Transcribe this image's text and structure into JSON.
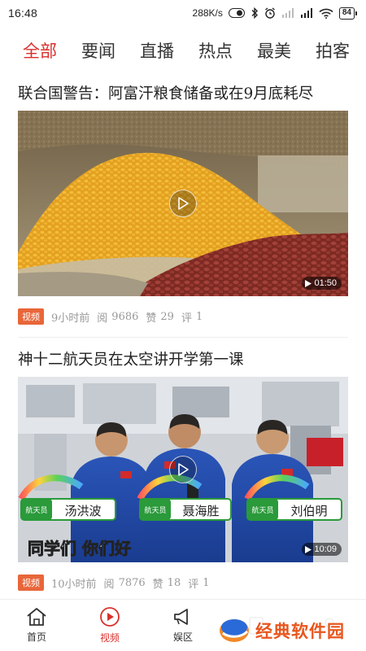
{
  "status_bar": {
    "time": "16:48",
    "network_speed": "288K/s",
    "battery": "84"
  },
  "tabs": [
    {
      "label": "全部",
      "active": true
    },
    {
      "label": "要闻",
      "active": false
    },
    {
      "label": "直播",
      "active": false
    },
    {
      "label": "热点",
      "active": false
    },
    {
      "label": "最美",
      "active": false
    },
    {
      "label": "拍客",
      "active": false
    }
  ],
  "articles": [
    {
      "title": "联合国警告：阿富汗粮食储备或在9月底耗尽",
      "duration": "01:50",
      "tag": "视频",
      "time": "9小时前",
      "reads_label": "阅",
      "reads": "9686",
      "likes_label": "赞",
      "likes": "29",
      "comments_label": "评",
      "comments": "1"
    },
    {
      "title": "神十二航天员在太空讲开学第一课",
      "duration": "10:09",
      "tag": "视频",
      "time": "10小时前",
      "reads_label": "阅",
      "reads": "7876",
      "likes_label": "赞",
      "likes": "18",
      "comments_label": "评",
      "comments": "1",
      "captions": {
        "name1": "汤洪波",
        "name2": "聂海胜",
        "name3": "刘伯明",
        "role": "航天员",
        "subtitle": "同学们 你们好"
      }
    }
  ],
  "bottom_nav": [
    {
      "label": "首页",
      "icon": "home-icon",
      "active": false
    },
    {
      "label": "视频",
      "icon": "play-circle-icon",
      "active": true
    },
    {
      "label": "娱区",
      "icon": "megaphone-icon",
      "active": false
    }
  ],
  "watermark": {
    "text": "经典软件园"
  },
  "colors": {
    "accent": "#d9302c",
    "tag": "#e8663a",
    "meta_text": "#999999"
  }
}
